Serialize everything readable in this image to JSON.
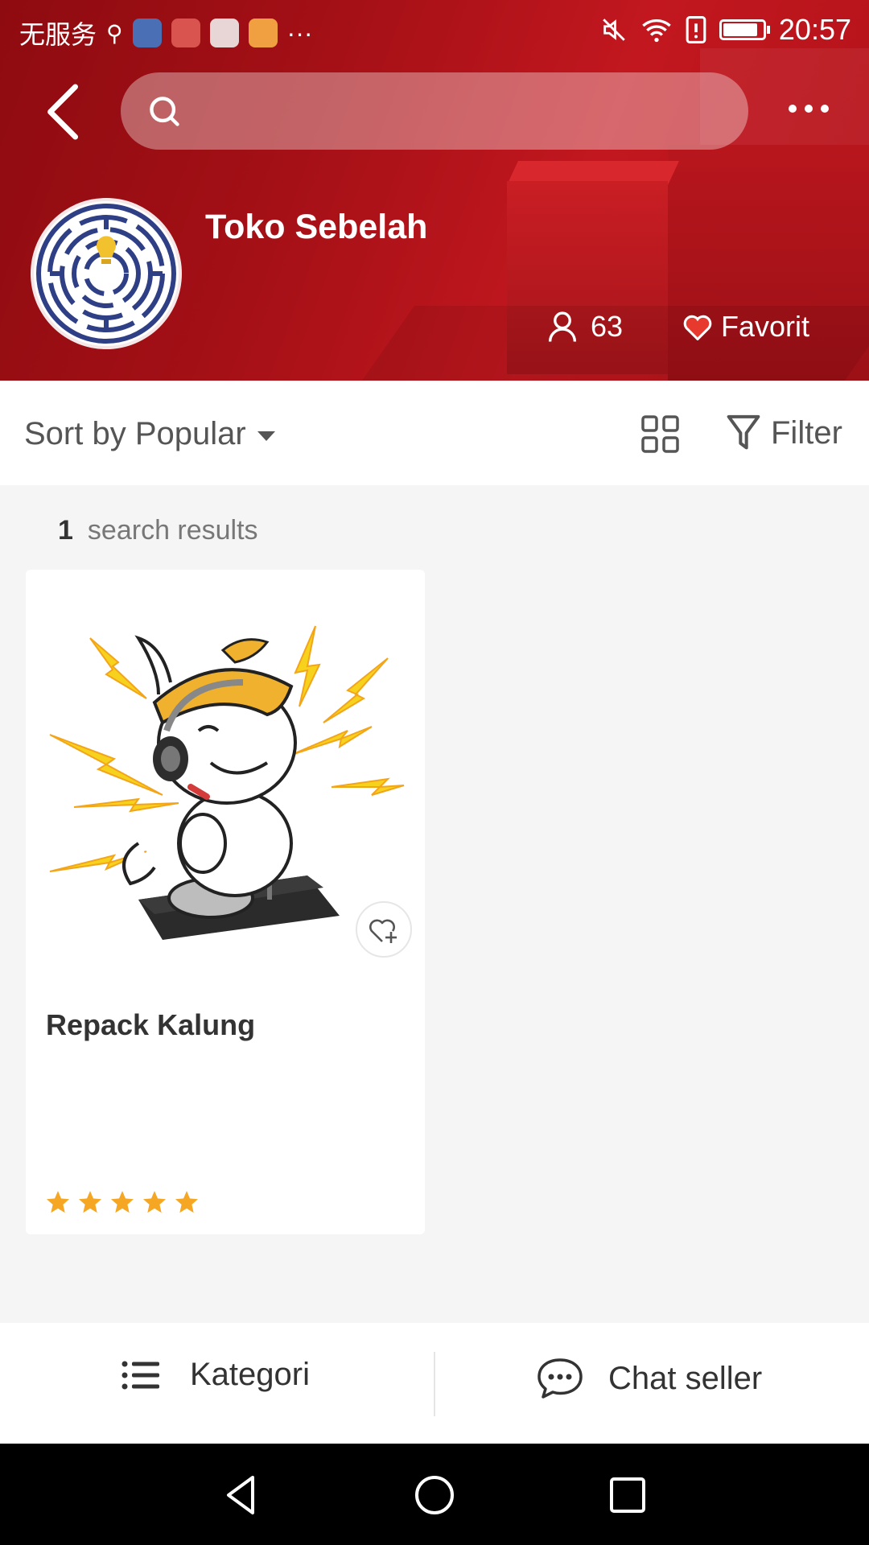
{
  "status_bar": {
    "carrier": "无服务",
    "time": "20:57"
  },
  "header": {
    "search": {
      "placeholder": ""
    },
    "shop_name": "Toko Sebelah",
    "followers_count": "63",
    "favorite_label": "Favorit"
  },
  "toolbar": {
    "sort_label": "Sort by Popular",
    "filter_label": "Filter"
  },
  "results": {
    "count": "1",
    "count_label": "search results",
    "products": [
      {
        "name": "Repack Kalung",
        "rating": 5
      }
    ]
  },
  "bottom_bar": {
    "category_label": "Kategori",
    "chat_label": "Chat seller"
  },
  "colors": {
    "header_red": "#a41016",
    "star": "#f5a623",
    "favorite_heart": "#e8392f"
  },
  "icons": [
    "back-icon",
    "search-icon",
    "more-icon",
    "user-icon",
    "heart-icon",
    "grid-icon",
    "filter-icon",
    "wishlist-add-icon",
    "star-icon",
    "list-icon",
    "chat-icon"
  ]
}
